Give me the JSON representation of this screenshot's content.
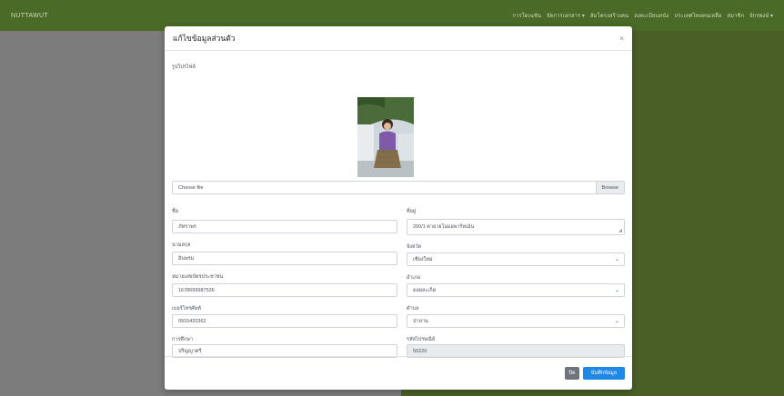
{
  "navbar": {
    "brand": "NUTTAWUT",
    "links": [
      "การโดเนชัน",
      "จัดการเอกสาร ▾",
      "สัมโครงสร้างคน",
      "ลงทะเบียนหนัง",
      "ประเทศไทยคนเหลือ",
      "สมาชิก",
      "จักรพงษ์ ▾"
    ]
  },
  "modal": {
    "title": "แก้ไขข้อมูลส่วนตัว",
    "close_symbol": "×",
    "profile_label": "รูปโปรไฟล์",
    "file_placeholder": "Choose file",
    "browse_label": "Browse",
    "fields": {
      "name_label": "ชื่อ",
      "name_value": "ภัทราพร",
      "surname_label": "นามสกุล",
      "surname_value": "อินพรม",
      "id_label": "หมายเลขบัตรประชาชน",
      "id_value": "1678699987536",
      "phone_label": "เบอร์โทรศัพท์",
      "phone_value": "0915420362",
      "edu_label": "การศึกษา",
      "edu_value": "ปริญญาตรี",
      "address_label": "ที่อยู่",
      "address_value": "200/1 ตายายโอมอพาร์ทเม้น",
      "province_label": "จังหวัด",
      "province_value": "เชียงใหม่",
      "district_label": "อำเภอ",
      "district_value": "ดอยสะเก็ด",
      "subdistrict_label": "ตำบล",
      "subdistrict_value": "ป่าลาน",
      "zip_label": "รหัสไปรษณีย์",
      "zip_value": "50220"
    },
    "close_button": "ปิด",
    "save_button": "บันทึกข้อมูล"
  }
}
